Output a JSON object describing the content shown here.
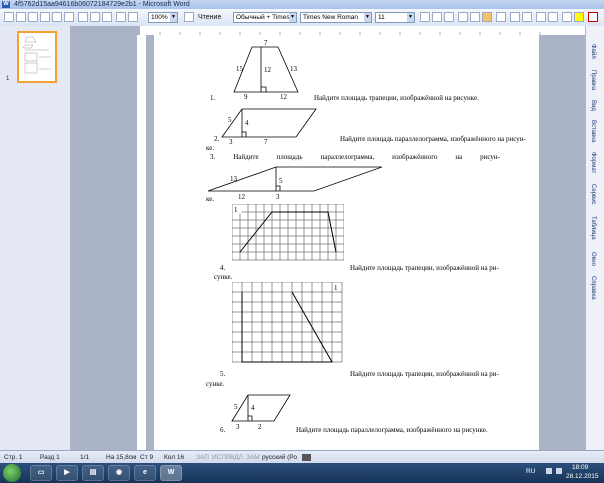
{
  "window": {
    "title": "4f5762d15aa94616b06072184729e2b1 - Microsoft Word"
  },
  "toolbar": {
    "zoom": "100%",
    "reading": "Чтение",
    "style": "Обычный + Times",
    "font": "Times New Roman",
    "size": "11"
  },
  "thumbs": {
    "page_number": "1"
  },
  "document": {
    "q1": {
      "num": "1.",
      "text": "Найдите площадь трапеции, изображённой на рисунке.",
      "labels": [
        "7",
        "15",
        "12",
        "13",
        "9",
        "12"
      ]
    },
    "q2": {
      "num": "2.",
      "text": "Найдите площадь параллелограмма, изображённого на рисун-",
      "cont": "ке.",
      "labels": [
        "5",
        "4",
        "3",
        "7"
      ]
    },
    "q3": {
      "num": "3.",
      "text": "Найдите площадь параллелограмма, изображённого на рисун-",
      "cont": "ке.",
      "labels": [
        "13",
        "5",
        "12",
        "3"
      ]
    },
    "q4": {
      "num": "4.",
      "text": "Найдите площадь трапеции, изображённой на ри-",
      "cont": "сунке.",
      "grid_label": "1"
    },
    "q5": {
      "num": "5.",
      "text": "Найдите площадь трапеции, изображённой на ри-",
      "cont": "сунке.",
      "grid_label": "1"
    },
    "q6": {
      "num": "6.",
      "text": "Найдите площадь параллелограмма, изображённого на рисунке.",
      "labels": [
        "5",
        "4",
        "3",
        "2"
      ]
    }
  },
  "sidepanel": [
    "Файл",
    "Правка",
    "Вид",
    "Вставка",
    "Формат",
    "Сервис",
    "Таблица",
    "Окно",
    "Справка"
  ],
  "status": {
    "page": "Стр. 1",
    "section": "Разд 1",
    "pages": "1/1",
    "position": "На 15,8см",
    "line": "Ст 9",
    "column": "Кол 16",
    "rec": "ЗАП",
    "trk": "ИСПР",
    "ext": "ВДЛ",
    "ovr": "ЗАМ",
    "lang": "русский (Ро"
  },
  "taskbar": {
    "lang": "RU",
    "time": "18:09",
    "date": "28.12.2015"
  },
  "colors": {
    "accent": "#2b5fb4",
    "page": "#ffffff",
    "workspace": "#aab3c6"
  }
}
